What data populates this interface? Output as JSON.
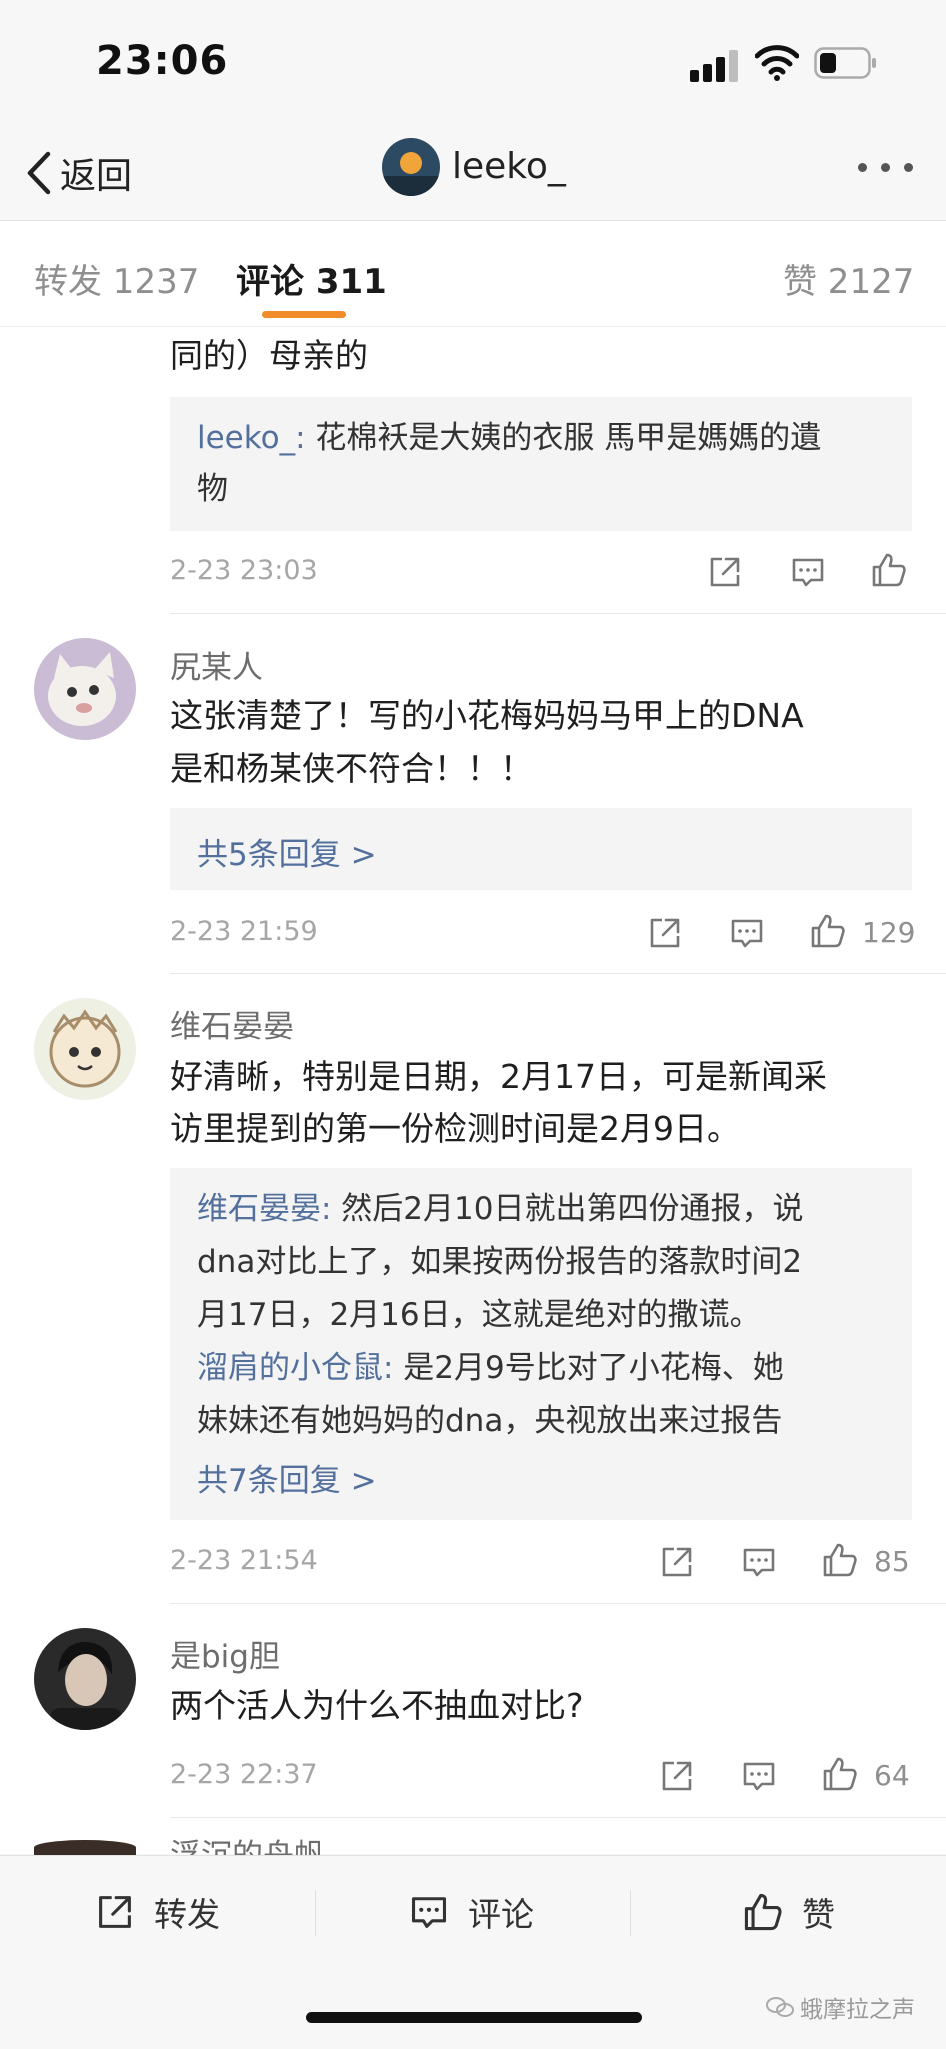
{
  "status": {
    "time": "23:06"
  },
  "nav": {
    "back_label": "返回",
    "title": "leeko_"
  },
  "tabs": [
    {
      "label": "转发 1237"
    },
    {
      "label": "评论 311"
    },
    {
      "label": "赞 2127"
    }
  ],
  "comments": [
    {
      "text_lines": [
        "同的）母亲的"
      ],
      "replies": [
        {
          "user": "leeko_:",
          "lines": [
            " 花棉袄是大姨的衣服 馬甲是媽媽的遺",
            "物"
          ]
        }
      ],
      "time": "2-23 23:03",
      "likes": ""
    },
    {
      "user": "尻某人",
      "text_lines": [
        "这张清楚了！写的小花梅妈妈马甲上的DNA",
        "是和杨某侠不符合！！！"
      ],
      "more_replies": "共5条回复 >",
      "time": "2-23 21:59",
      "likes": "129"
    },
    {
      "user": "维石晏晏",
      "text_lines": [
        "好清晰，特别是日期，2月17日，可是新闻采",
        "访里提到的第一份检测时间是2月9日。"
      ],
      "replies": [
        {
          "user": "维石晏晏:",
          "lines": [
            " 然后2月10日就出第四份通报，说",
            "dna对比上了，如果按两份报告的落款时间2",
            "月17日，2月16日，这就是绝对的撒谎。"
          ]
        },
        {
          "user": "溜肩的小仓鼠:",
          "lines": [
            " 是2月9号比对了小花梅、她",
            "妹妹还有她妈妈的dna，央视放出来过报告"
          ]
        }
      ],
      "more_replies": "共7条回复 >",
      "time": "2-23 21:54",
      "likes": "85"
    },
    {
      "user": "是big胆",
      "text_lines": [
        "两个活人为什么不抽血对比?"
      ],
      "time": "2-23 22:37",
      "likes": "64"
    },
    {
      "user": "浮沉的舟帆"
    }
  ],
  "bottom_bar": {
    "repost": "转发",
    "comment": "评论",
    "like": "赞"
  },
  "watermark": "蛾摩拉之声",
  "colors": {
    "accent": "#f28b2a",
    "link": "#53709d"
  }
}
